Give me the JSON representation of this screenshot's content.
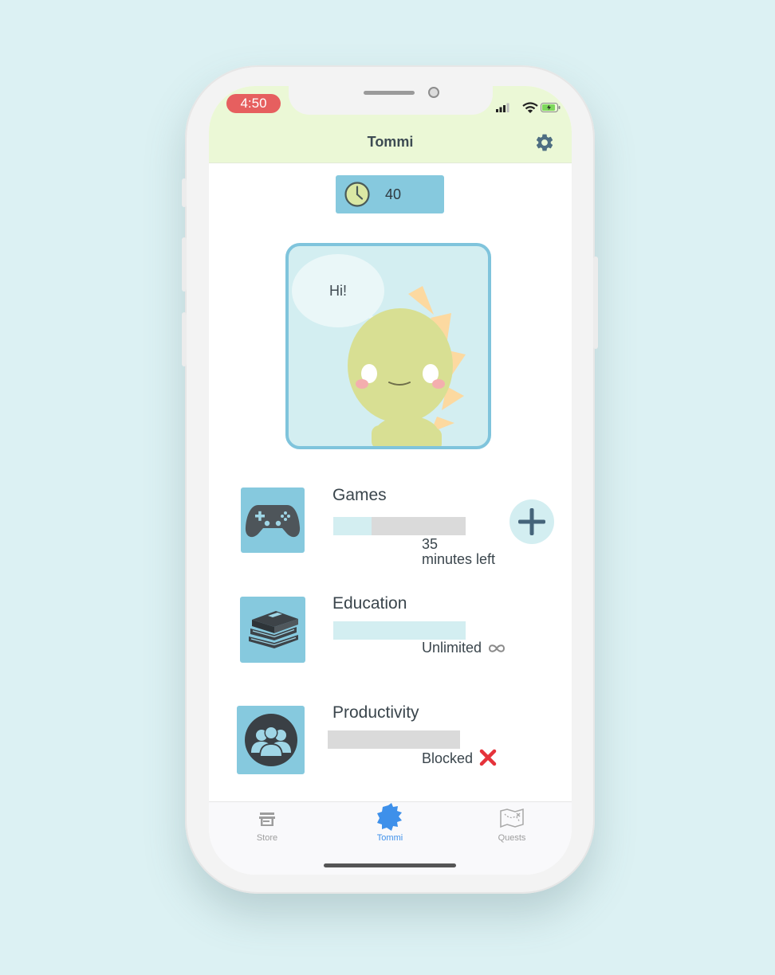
{
  "status_bar": {
    "time": "4:50"
  },
  "header": {
    "title": "Tommi",
    "settings_icon": "gear-icon"
  },
  "timer": {
    "icon": "clock-icon",
    "value": "40"
  },
  "pet": {
    "speech": "Hi!"
  },
  "apps": [
    {
      "name": "Games",
      "icon": "gamepad-icon",
      "status": "35",
      "status_line2": "minutes left",
      "progress": 0.29,
      "action_icon": "plus-icon"
    },
    {
      "name": "Education",
      "icon": "books-icon",
      "status": "Unlimited",
      "status_icon": "infinity-icon",
      "progress": 1.0
    },
    {
      "name": "Productivity",
      "icon": "people-icon",
      "status": "Blocked",
      "status_icon": "red-x-icon",
      "progress": 0.0
    }
  ],
  "tabs": [
    {
      "label": "Store",
      "icon": "store-icon",
      "active": false
    },
    {
      "label": "Tommi",
      "icon": "pet-icon",
      "active": true
    },
    {
      "label": "Quests",
      "icon": "map-icon",
      "active": false
    }
  ],
  "colors": {
    "header_bg": "#ebf8d6",
    "accent_blue": "#86c9de",
    "light_blue": "#d3eef1",
    "active_tab": "#3e90ea",
    "blocked_red": "#e5333b",
    "time_pill": "#e65f5f"
  }
}
